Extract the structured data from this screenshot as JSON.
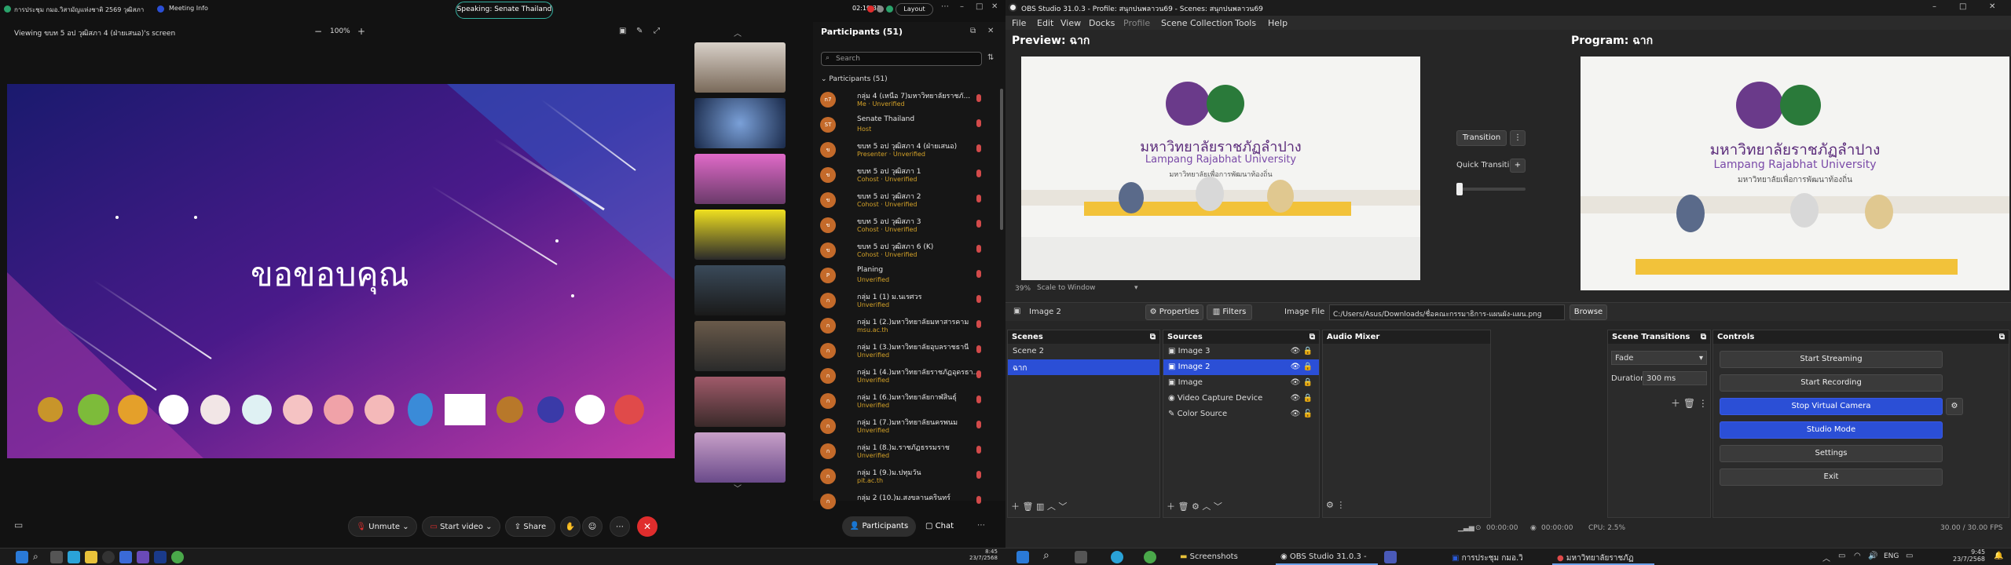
{
  "webex": {
    "meeting_title": "การประชุม กมอ.วิสามัญแห่งชาติ 2569 วุฒิสภา",
    "meeting_info": "Meeting Info",
    "timer": "02:19:37",
    "layout_label": "Layout",
    "speaking": "Speaking: Senate Thailand",
    "viewing": "Viewing ขบท 5 อป วุฒิสภา 4 (ฝ่ายเสนอ)'s screen",
    "zoom_level": "100%",
    "slide_text": "ขอขอบคุณ",
    "participants_header": "Participants (51)",
    "search_placeholder": "Search",
    "participants_group": "Participants (51)",
    "participants": [
      {
        "name": "กลุ่ม 4 (เหนือ 7)มหาวิทยาลัยราชภั...",
        "sub": "Me · Unverified",
        "av": "n7"
      },
      {
        "name": "Senate Thailand",
        "sub": "Host",
        "av": "ST"
      },
      {
        "name": "ขบท 5 อป วุฒิสภา 4 (ฝ่ายเสนอ)",
        "sub": "Presenter · Unverified",
        "av": "ข"
      },
      {
        "name": "ขบท 5 อป วุฒิสภา 1",
        "sub": "Cohost · Unverified",
        "av": "ข"
      },
      {
        "name": "ขบท 5 อป วุฒิสภา 2",
        "sub": "Cohost · Unverified",
        "av": "ข"
      },
      {
        "name": "ขบท 5 อป วุฒิสภา 3",
        "sub": "Cohost · Unverified",
        "av": "ข"
      },
      {
        "name": "ขบท 5 อป วุฒิสภา 6 (K)",
        "sub": "Cohost · Unverified",
        "av": "ข"
      },
      {
        "name": "Planing",
        "sub": "Unverified",
        "av": "P"
      },
      {
        "name": "กลุ่ม 1 (1) ม.นเรศวร",
        "sub": "Unverified",
        "av": "ก"
      },
      {
        "name": "กลุ่ม 1 (2.)มหาวิทยาลัยมหาสารคาม",
        "sub": "msu.ac.th",
        "av": "ก"
      },
      {
        "name": "กลุ่ม 1 (3.)มหาวิทยาลัยอุบลราชธานี",
        "sub": "Unverified",
        "av": "ก"
      },
      {
        "name": "กลุ่ม 1 (4.)มหาวิทยาลัยราชภัฏอุดรธา...",
        "sub": "Unverified",
        "av": "ก"
      },
      {
        "name": "กลุ่ม 1 (6.)มหาวิทยาลัยกาฬสินธุ์",
        "sub": "Unverified",
        "av": "ก"
      },
      {
        "name": "กลุ่ม 1 (7.)มหาวิทยาลัยนครพนม",
        "sub": "Unverified",
        "av": "ก"
      },
      {
        "name": "กลุ่ม 1 (8.)ม.ราชภัฏธรรมราช",
        "sub": "Unverified",
        "av": "ก"
      },
      {
        "name": "กลุ่ม 1 (9.)ม.ปทุมวัน",
        "sub": "pit.ac.th",
        "av": "ก"
      },
      {
        "name": "กลุ่ม 2 (10.)ม.สงขลานครินทร์",
        "sub": "",
        "av": "ก"
      }
    ],
    "controls": {
      "unmute": "Unmute",
      "start_video": "Start video",
      "share": "Share",
      "participants": "Participants",
      "chat": "Chat"
    }
  },
  "obs": {
    "title": "OBS Studio 31.0.3 - Profile: สนุกปนพลาวน69 - Scenes: สนุกปนพลาวน69",
    "menu": [
      "File",
      "Edit",
      "View",
      "Docks",
      "Profile",
      "Scene Collection",
      "Tools",
      "Help"
    ],
    "preview_label": "Preview: ฉาก",
    "program_label": "Program: ฉาก",
    "university_thai": "มหาวิทยาลัยราชภัฏลำปาง",
    "university_en": "Lampang Rajabhat University",
    "university_motto": "มหาวิทยาลัยเพื่อการพัฒนาท้องถิ่น",
    "transition_btn": "Transition",
    "quick_transitions": "Quick Transitions",
    "zoom_pct": "39%",
    "scale_mode": "Scale to Window",
    "selected_source": "Image 2",
    "properties": "Properties",
    "filters": "Filters",
    "image_file_label": "Image File",
    "image_file_path": "C:/Users/Asus/Downloads/ชื่อคณะกรรมาธิการ-แผนผัง-แผน.png",
    "browse": "Browse",
    "docks": {
      "scenes": "Scenes",
      "sources": "Sources",
      "audio_mixer": "Audio Mixer",
      "scene_transitions": "Scene Transitions",
      "controls": "Controls"
    },
    "scenes": [
      "Scene 2",
      "ฉาก"
    ],
    "sources": [
      "Image 3",
      "Image 2",
      "Image",
      "Video Capture Device",
      "Color Source"
    ],
    "transition_type": "Fade",
    "duration_label": "Duration",
    "duration_value": "300 ms",
    "control_buttons": {
      "start_streaming": "Start Streaming",
      "start_recording": "Start Recording",
      "stop_virtual_camera": "Stop Virtual Camera",
      "studio_mode": "Studio Mode",
      "settings": "Settings",
      "exit": "Exit"
    },
    "status": {
      "stream_time": "00:00:00",
      "rec_time": "00:00:00",
      "cpu": "CPU: 2.5%",
      "fps": "30.00 / 30.00 FPS"
    }
  },
  "taskbar": {
    "left_time": "8:45",
    "left_date": "23/7/2568",
    "apps": [
      "Screenshots",
      "OBS Studio 31.0.3 - ...",
      "การประชุม กมอ.วิสามั...",
      "มหาวิทยาลัยราชภัฏลำ..."
    ],
    "lang": "ENG",
    "right_time": "9:45",
    "right_date": "23/7/2568"
  },
  "colors": {
    "accent_blue": "#2b4fd6",
    "leave_red": "#e02d2d",
    "speaking_border": "#33b0a0"
  }
}
